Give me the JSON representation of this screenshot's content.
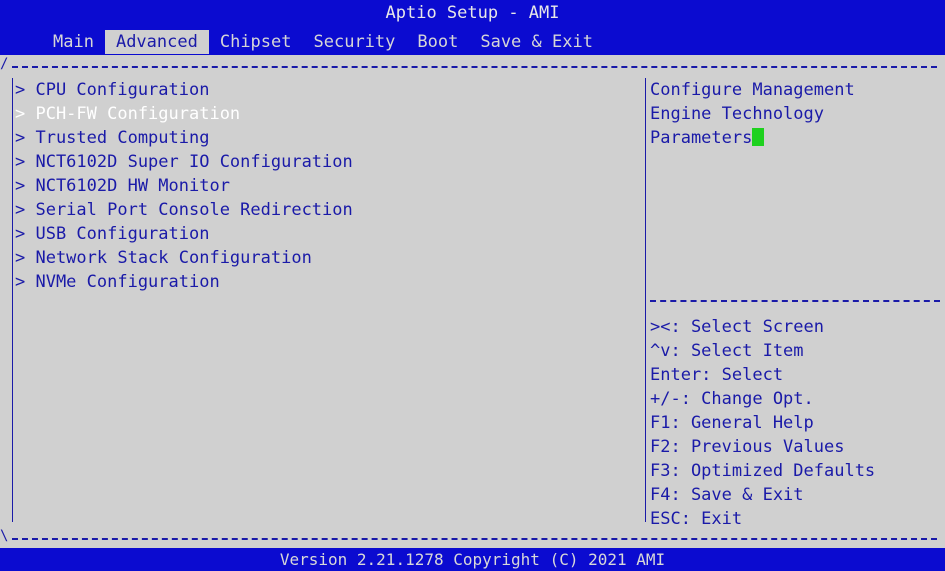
{
  "header": {
    "title": "Aptio Setup - AMI",
    "tabs": [
      "Main",
      "Advanced",
      "Chipset",
      "Security",
      "Boot",
      "Save & Exit"
    ],
    "active_tab": "Advanced"
  },
  "menu": {
    "items": [
      "> CPU Configuration",
      "> PCH-FW Configuration",
      "> Trusted Computing",
      "> NCT6102D Super IO Configuration",
      "> NCT6102D HW Monitor",
      "> Serial Port Console Redirection",
      "> USB Configuration",
      "> Network Stack Configuration",
      "> NVMe Configuration"
    ],
    "selected_index": 1
  },
  "help": {
    "lines": [
      "Configure Management",
      "Engine Technology",
      "Parameters"
    ]
  },
  "keys": {
    "lines": [
      "><: Select Screen",
      "^v: Select Item",
      "Enter: Select",
      "+/-: Change Opt.",
      "F1: General Help",
      "F2: Previous Values",
      "F3: Optimized Defaults",
      "F4: Save & Exit",
      "ESC: Exit"
    ]
  },
  "footer": {
    "text": "Version 2.21.1278 Copyright (C) 2021 AMI"
  },
  "colors": {
    "bar": "#0b0bd0",
    "background": "#d0d0d0",
    "text": "#1a1aa8",
    "selected": "#ffffff",
    "cursor": "#1ed11e"
  }
}
